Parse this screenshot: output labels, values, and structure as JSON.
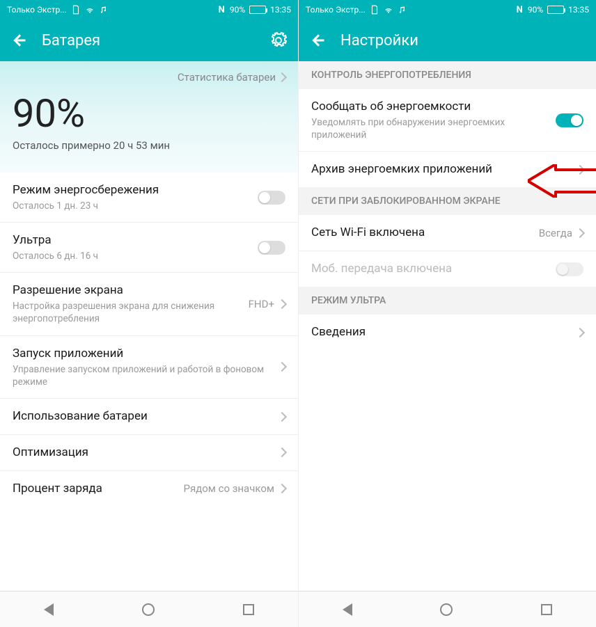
{
  "status": {
    "carrier": "Только Экстр...",
    "nfc": "N",
    "battery_pct": "90%",
    "time": "13:35"
  },
  "left": {
    "title": "Батарея",
    "stats_link": "Статистика батареи",
    "percent": "90%",
    "remaining": "Осталось примерно 20 ч 53 мин",
    "rows": {
      "power_save": {
        "label": "Режим энергосбережения",
        "sub": "Осталось 1 дн. 23 ч"
      },
      "ultra": {
        "label": "Ультра",
        "sub": "Осталось 6 дн. 16 ч"
      },
      "res": {
        "label": "Разрешение экрана",
        "sub": "Настройка разрешения экрана для снижения энергопотребления",
        "value": "FHD+"
      },
      "launch": {
        "label": "Запуск приложений",
        "sub": "Управление запуском приложений и работой в фоновом режиме"
      },
      "usage": {
        "label": "Использование батареи"
      },
      "optim": {
        "label": "Оптимизация"
      },
      "pct_badge": {
        "label": "Процент заряда",
        "value": "Рядом со значком"
      }
    }
  },
  "right": {
    "title": "Настройки",
    "sections": {
      "power_ctrl": "КОНТРОЛЬ ЭНЕРГОПОТРЕБЛЕНИЯ",
      "locked_net": "СЕТИ ПРИ ЗАБЛОКИРОВАННОМ ЭКРАНЕ",
      "ultra_mode": "РЕЖИМ УЛЬТРА"
    },
    "rows": {
      "notify": {
        "label": "Сообщать об энергоемкости",
        "sub": "Уведомлять при обнаружении энергоемких приложений"
      },
      "archive": {
        "label": "Архив энергоемких приложений"
      },
      "wifi": {
        "label": "Сеть Wi-Fi включена",
        "value": "Всегда"
      },
      "mobi": {
        "label": "Моб. передача включена"
      },
      "info": {
        "label": "Сведения"
      }
    }
  }
}
